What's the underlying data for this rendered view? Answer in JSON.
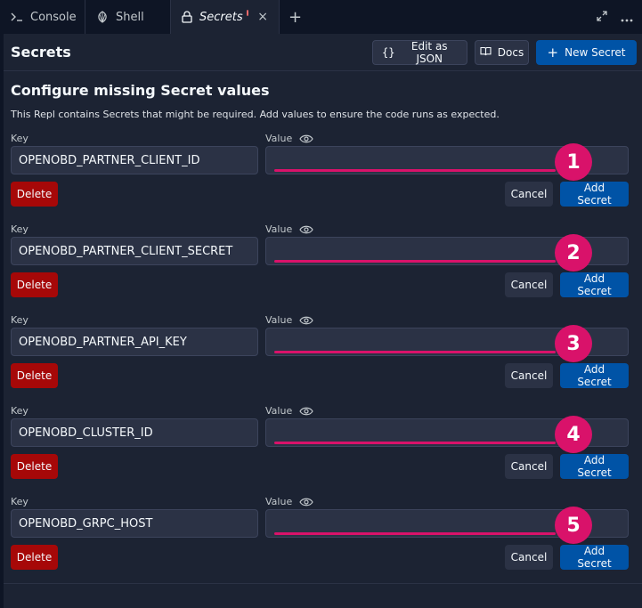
{
  "tabs": [
    {
      "label": "Console",
      "icon": "terminal-icon",
      "active": false
    },
    {
      "label": "Shell",
      "icon": "shell-icon",
      "active": false
    },
    {
      "label": "Secrets",
      "icon": "lock-icon",
      "active": true
    }
  ],
  "tabbar": {
    "add": "+",
    "close": "×"
  },
  "header": {
    "title": "Secrets",
    "edit_json": "Edit as JSON",
    "edit_json_icon": "{}",
    "docs": "Docs",
    "new_secret": "New Secret",
    "new_secret_icon": "+"
  },
  "section": {
    "title": "Configure missing Secret values",
    "description": "This Repl contains Secrets that might be required. Add values to ensure the code runs as expected."
  },
  "labels": {
    "key": "Key",
    "value": "Value",
    "delete": "Delete",
    "cancel": "Cancel",
    "add": "Add Secret"
  },
  "secrets": [
    {
      "key": "OPENOBD_PARTNER_CLIENT_ID",
      "value": "",
      "marker": "1"
    },
    {
      "key": "OPENOBD_PARTNER_CLIENT_SECRET",
      "value": "",
      "marker": "2"
    },
    {
      "key": "OPENOBD_PARTNER_API_KEY",
      "value": "",
      "marker": "3"
    },
    {
      "key": "OPENOBD_CLUSTER_ID",
      "value": "",
      "marker": "4"
    },
    {
      "key": "OPENOBD_GRPC_HOST",
      "value": "",
      "marker": "5"
    }
  ],
  "colors": {
    "accent": "#d9126a",
    "primary": "#0053a6",
    "danger": "#a60808",
    "background": "#1c2333"
  }
}
